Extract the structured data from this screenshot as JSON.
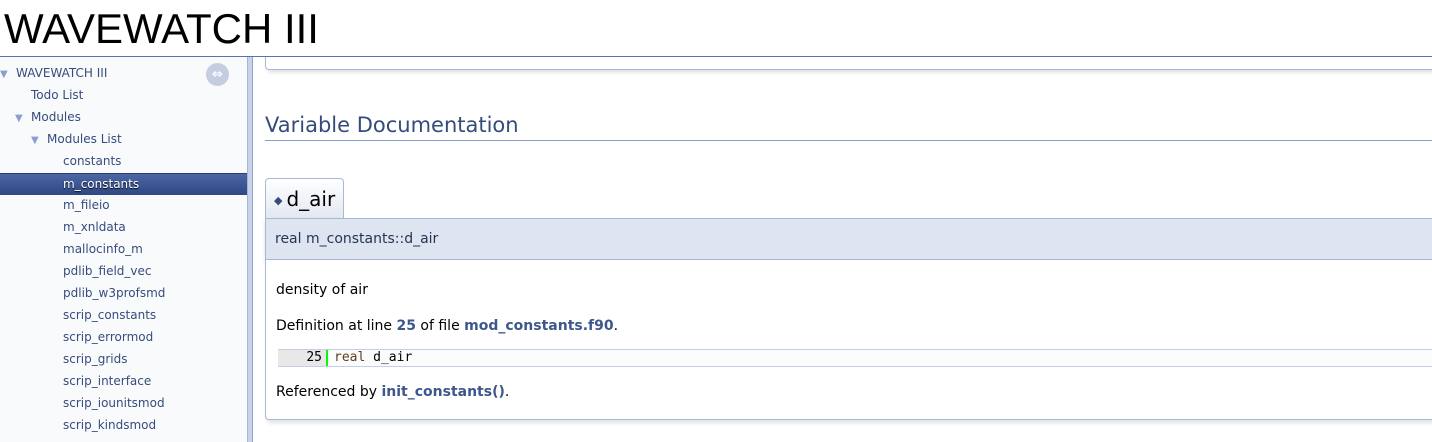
{
  "header": {
    "project_name": "WAVEWATCH III"
  },
  "sidebar": {
    "items": [
      {
        "label": "WAVEWATCH III",
        "arrow": "▼"
      },
      {
        "label": "Todo List",
        "arrow": ""
      },
      {
        "label": "Modules",
        "arrow": "▼"
      },
      {
        "label": "Modules List",
        "arrow": "▼"
      },
      {
        "label": "constants",
        "arrow": ""
      },
      {
        "label": "m_constants",
        "arrow": "",
        "selected": true
      },
      {
        "label": "m_fileio",
        "arrow": ""
      },
      {
        "label": "m_xnldata",
        "arrow": ""
      },
      {
        "label": "mallocinfo_m",
        "arrow": ""
      },
      {
        "label": "pdlib_field_vec",
        "arrow": ""
      },
      {
        "label": "pdlib_w3profsmd",
        "arrow": ""
      },
      {
        "label": "scrip_constants",
        "arrow": ""
      },
      {
        "label": "scrip_errormod",
        "arrow": ""
      },
      {
        "label": "scrip_grids",
        "arrow": ""
      },
      {
        "label": "scrip_interface",
        "arrow": ""
      },
      {
        "label": "scrip_iounitsmod",
        "arrow": ""
      },
      {
        "label": "scrip_kindsmod",
        "arrow": ""
      }
    ],
    "sync_icon": "sync-arrows-icon"
  },
  "content": {
    "section_title": "Variable Documentation",
    "member": {
      "name": "d_air",
      "prototype": "real m_constants::d_air",
      "description": "density of air",
      "definition_prefix": "Definition at line ",
      "line_number": "25",
      "definition_mid": " of file ",
      "file_name": "mod_constants.f90",
      "definition_suffix": ".",
      "code_line_number": "25",
      "code_keyword": "real",
      "code_rest": " d_air",
      "referenced_prefix": "Referenced by ",
      "referenced_link": "init_constants()",
      "referenced_suffix": "."
    }
  }
}
